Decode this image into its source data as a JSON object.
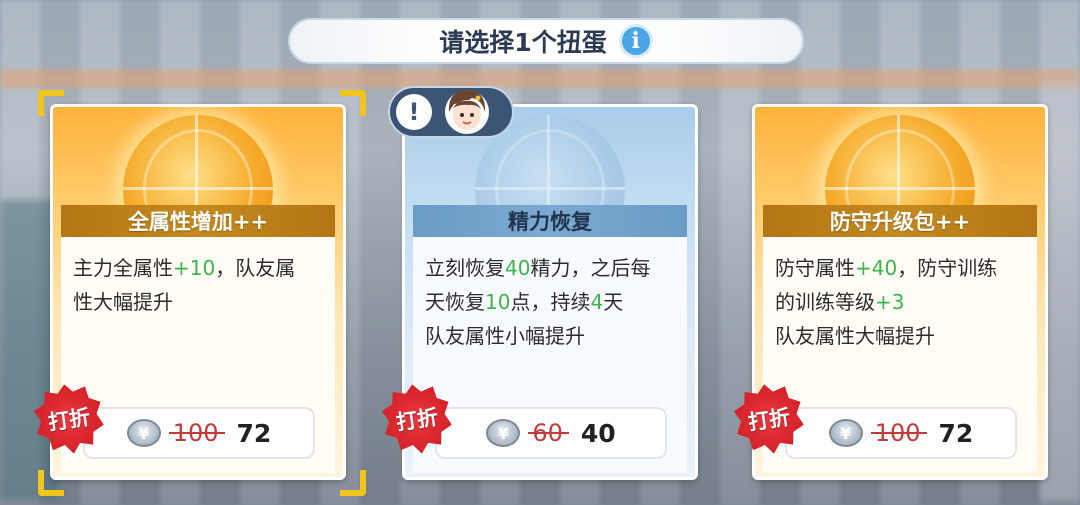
{
  "header": {
    "title": "请选择1个扭蛋",
    "info_icon": "info-icon"
  },
  "cards": [
    {
      "name": "全属性增加++",
      "theme": "gold",
      "selected": true,
      "desc_lines": [
        [
          {
            "t": "主力全属性"
          },
          {
            "t": "+10",
            "hl": true
          },
          {
            "t": "，队友属"
          }
        ],
        [
          {
            "t": "性大幅提升"
          }
        ]
      ],
      "badge": "打折",
      "old_price": "100",
      "new_price": "72"
    },
    {
      "name": "精力恢复",
      "theme": "blue",
      "selected": false,
      "desc_lines": [
        [
          {
            "t": "立刻恢复"
          },
          {
            "t": "40",
            "hl": true
          },
          {
            "t": "精力，之后每"
          }
        ],
        [
          {
            "t": "天恢复"
          },
          {
            "t": "10",
            "hl": true
          },
          {
            "t": "点，持续"
          },
          {
            "t": "4",
            "hl": true
          },
          {
            "t": "天"
          }
        ],
        [
          {
            "t": "队友属性小幅提升"
          }
        ]
      ],
      "badge": "打折",
      "old_price": "60",
      "new_price": "40"
    },
    {
      "name": "防守升级包++",
      "theme": "gold",
      "selected": false,
      "desc_lines": [
        [
          {
            "t": "防守属性"
          },
          {
            "t": "+40",
            "hl": true
          },
          {
            "t": "，防守训练"
          }
        ],
        [
          {
            "t": "的训练等级"
          },
          {
            "t": "+3",
            "hl": true
          }
        ],
        [
          {
            "t": "队友属性大幅提升"
          }
        ]
      ],
      "badge": "打折",
      "old_price": "100",
      "new_price": "72"
    }
  ],
  "currency_icon": "coin-icon",
  "currency_symbol": "¥",
  "character_tag": {
    "alert_icon": "exclamation-icon",
    "alert_symbol": "!",
    "avatar": "character-avatar"
  },
  "colors": {
    "highlight": "#3cb44a",
    "old_price": "#c23a3a",
    "badge": "#d8242c",
    "selection": "#f2c51c"
  }
}
